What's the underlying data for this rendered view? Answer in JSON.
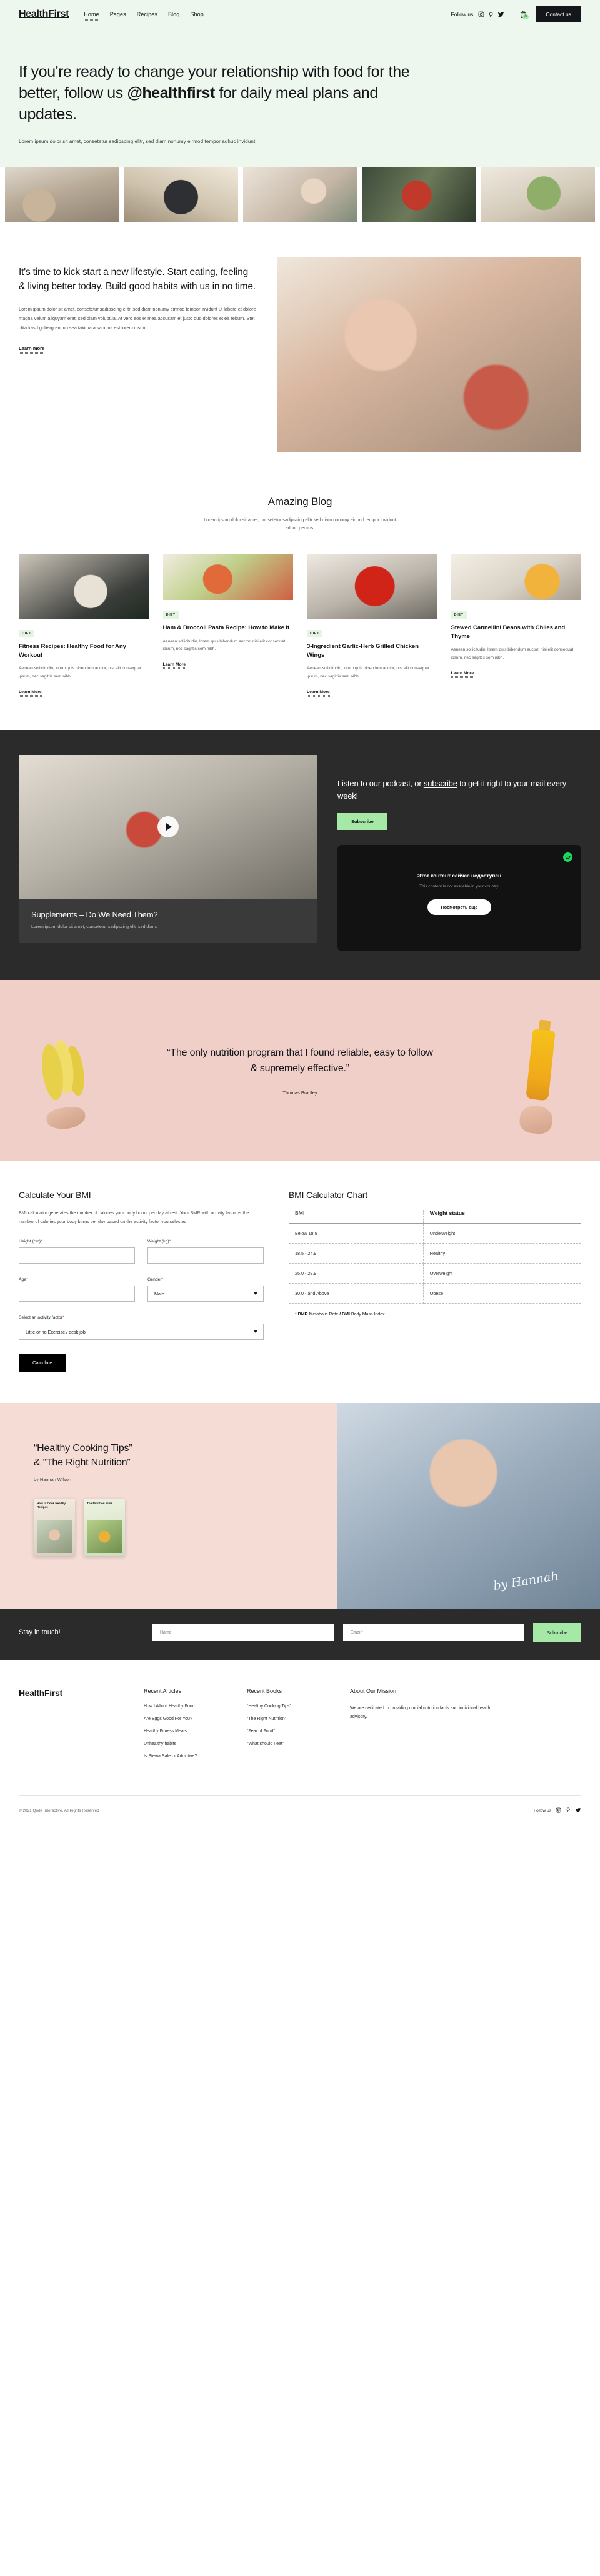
{
  "brand": "HealthFirst",
  "nav": {
    "links": [
      {
        "label": "Home",
        "active": true
      },
      {
        "label": "Pages",
        "active": false
      },
      {
        "label": "Recipes",
        "active": false
      },
      {
        "label": "Blog",
        "active": false
      },
      {
        "label": "Shop",
        "active": false
      }
    ],
    "follow_label": "Follow us",
    "social": [
      "instagram-icon",
      "pinterest-icon",
      "twitter-icon"
    ],
    "cart_count": "0",
    "contact_label": "Contact us"
  },
  "hero": {
    "heading_pre": "If you're ready to change your relationship with food for the better, follow us ",
    "heading_strong": "@healthfirst",
    "heading_post": " for daily meal plans and updates.",
    "subtext": "Lorem ipsum dolor sit amet, consetetur sadipscing elitr, sed diam nonumy eirmod tempor adhuc invidunt."
  },
  "strip": [
    {
      "name": "photo-kitchen-couple"
    },
    {
      "name": "photo-phone-food"
    },
    {
      "name": "photo-smoothie-woman"
    },
    {
      "name": "photo-salad-bowl"
    },
    {
      "name": "photo-healthy-plate"
    }
  ],
  "lifestyle": {
    "heading": "It's time to kick start a new lifestyle. Start eating, feeling & living better today. Build good habits with us in no time.",
    "body": "Lorem ipsum dolor sit amet, consetetur sadipscing elitr, sed diam nonumy eirmod tempor invidunt ut labore et dolore magna velum aliquyam erat, sed diam voluptua. At vero eos et mea accusam et justo duo dolores et ea rebum. Stet clita kasd gubergren, no sea takimata sanctus est lorem ipsum.",
    "link": "Learn more"
  },
  "blog": {
    "title": "Amazing Blog",
    "subtitle": "Lorem ipsum dolor sit amet, consetetur sadipscing elitr sed diam nonumy eirmod tempor invidunt adhuc persius.",
    "cards": [
      {
        "tag": "DIET",
        "title": "Fitness Recipes: Healthy Food for Any Workout",
        "excerpt": "Aenean sollicitudin, lorem quis bibendum auctor, nisi elit consequat ipsum, nec sagittis sem nibh.",
        "link": "Learn More"
      },
      {
        "tag": "DIET",
        "title": "Ham & Broccoli Pasta Recipe: How to Make It",
        "excerpt": "Aenean sollicitudin, lorem quis bibendum auctor, nisi elit consequat ipsum, nec sagittis sem nibh.",
        "link": "Learn More"
      },
      {
        "tag": "DIET",
        "title": "3-Ingredient Garlic-Herb Grilled Chicken Wings",
        "excerpt": "Aenean sollicitudin, lorem quis bibendum auctor, nisi elit consequat ipsum, nec sagittis sem nibh.",
        "link": "Learn More"
      },
      {
        "tag": "DIET",
        "title": "Stewed Cannellini Beans with Chiles and Thyme",
        "excerpt": "Aenean sollicitudin, lorem quis bibendum auctor, nisi elit consequat ipsum, nec sagittis sem nibh.",
        "link": "Learn More"
      }
    ]
  },
  "podcast": {
    "video_title": "Supplements – Do We Need Them?",
    "video_sub": "Lorem ipsum dolor sit amet, consetetur sadipscing elitr sed diam.",
    "heading_pre": "Listen to our podcast, or ",
    "heading_link": "subscribe",
    "heading_post": " to get it right to your mail every week!",
    "subscribe_label": "Subscribe",
    "embed": {
      "title_ru": "Этот контент сейчас недоступен",
      "subtitle_en": "This content is not available in your country.",
      "button_ru": "Посмотреть еще",
      "provider": "spotify-icon"
    }
  },
  "quote": {
    "text": "“The only nutrition program that I found reliable, easy to follow & supremely effective.”",
    "author": "Thomas Bradley"
  },
  "bmi": {
    "title": "Calculate Your BMI",
    "description": "BMI calculator generates the number of calories your body burns per day at rest. Your BMR with activity factor is the number of calories your body burns per day based on the activity factor you selected.",
    "fields": {
      "height_label": "Height (cm)",
      "height_value": "",
      "weight_label": "Weight (kg)",
      "weight_value": "",
      "age_label": "Age",
      "age_value": "",
      "gender_label": "Gender",
      "gender_value": "Male",
      "activity_label": "Select an activity factor",
      "activity_value": "Little or no Exercise / desk job"
    },
    "submit_label": "Calculate",
    "chart_title": "BMI Calculator Chart",
    "note_prefix": "* ",
    "note_b1": "BMR",
    "note_m1": " Metabolic Rate ",
    "note_b2": "/ BMI",
    "note_m2": " Body Mass Index"
  },
  "chart_data": {
    "type": "table",
    "title": "BMI Calculator Chart",
    "columns": [
      "BMI",
      "Weight status"
    ],
    "rows": [
      [
        "Below 18.5",
        "Underweight"
      ],
      [
        "18.5 - 24.9",
        "Healthy"
      ],
      [
        "25.0 - 29.9",
        "Overweight"
      ],
      [
        "30.0 - and Above",
        "Obese"
      ]
    ],
    "footnote": "* BMR Metabolic Rate / BMI Body Mass Index"
  },
  "books": {
    "heading_l1": "“Healthy Cooking Tips”",
    "heading_l2": "& “The Right Nutrition”",
    "by": "by Hannah Wilson",
    "cover1": "How to Cook Healthy Recipes",
    "cover2": "The Nutrition Bible",
    "signature": "by Hannah"
  },
  "newsletter": {
    "label": "Stay in touch!",
    "name_placeholder": "Name",
    "name_value": "",
    "email_placeholder": "Email*",
    "email_value": "",
    "submit_label": "Subscribe"
  },
  "footer": {
    "brand": "HealthFirst",
    "col1": {
      "title": "Recent Articles",
      "links": [
        "How I Afford Healthy Food",
        "Are Eggs Good For You?",
        "Healthy Fitness Meals",
        "Unhealthy habits",
        "Is Stevia Safe or Addictive?"
      ]
    },
    "col2": {
      "title": "Recent Books",
      "links": [
        "“Healthy Cooking Tips”",
        "“The Right Nutrition”",
        "“Fear of Food”",
        "“What should I eat”"
      ]
    },
    "col3": {
      "title": "About Our Mission",
      "text": "We are dedicated to providing crucial nutrition facts and individual health advisory."
    },
    "copyright": "© 2021 Qode Interactive, All Rights Reserved",
    "follow_label": "Follow us"
  },
  "colors": {
    "mint": "#eef7ed",
    "green": "#a6e9a6",
    "dark": "#2b2b2b",
    "pink": "#f0cfc9",
    "blush": "#f5ddd6",
    "required": "#e0322b"
  }
}
